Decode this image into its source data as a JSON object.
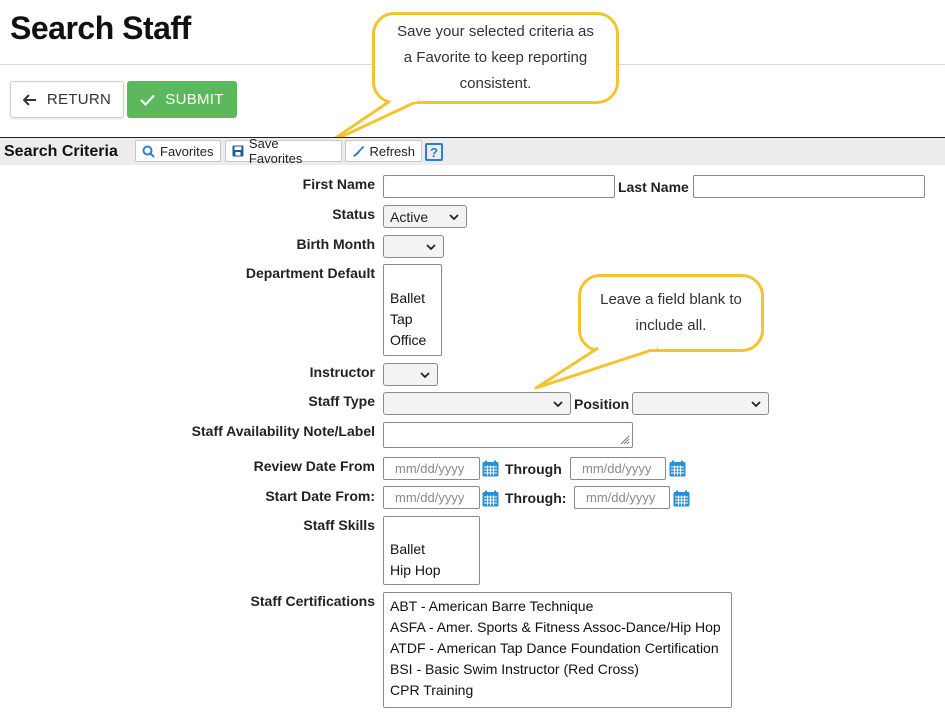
{
  "page": {
    "title": "Search Staff"
  },
  "actions": {
    "return_label": "RETURN",
    "submit_label": "SUBMIT"
  },
  "criteria_bar": {
    "title": "Search Criteria",
    "favorites_label": "Favorites",
    "save_favorites_label": "Save Favorites",
    "refresh_label": "Refresh",
    "help_label": "?"
  },
  "callouts": {
    "favorites_tip": "Save your selected criteria as a Favorite to keep reporting consistent.",
    "blank_tip": "Leave a field blank to include all."
  },
  "form": {
    "first_name": {
      "label": "First Name",
      "value": ""
    },
    "last_name": {
      "label": "Last Name",
      "value": ""
    },
    "status": {
      "label": "Status",
      "value": "Active"
    },
    "birth_month": {
      "label": "Birth Month",
      "value": ""
    },
    "department_default": {
      "label": "Department Default",
      "options": [
        "Ballet",
        "Tap",
        "Office"
      ]
    },
    "instructor": {
      "label": "Instructor",
      "value": ""
    },
    "staff_type": {
      "label": "Staff Type",
      "value": ""
    },
    "position": {
      "label": "Position",
      "value": ""
    },
    "availability_note": {
      "label": "Staff Availability Note/Label",
      "value": ""
    },
    "review_date": {
      "label": "Review Date From",
      "through_label": "Through",
      "placeholder": "mm/dd/yyyy"
    },
    "start_date": {
      "label": "Start Date From:",
      "through_label": "Through:",
      "placeholder": "mm/dd/yyyy"
    },
    "staff_skills": {
      "label": "Staff Skills",
      "options": [
        "Ballet",
        "Hip Hop"
      ]
    },
    "staff_certifications": {
      "label": "Staff Certifications",
      "options": [
        "ABT - American Barre Technique",
        "ASFA - Amer. Sports & Fitness Assoc-Dance/Hip Hop",
        "ATDF - American Tap Dance Foundation Certification",
        "BSI - Basic Swim Instructor (Red Cross)",
        "CPR Training"
      ]
    }
  },
  "colors": {
    "submit_green": "#5cb85c",
    "callout_border": "#f4c430",
    "link_blue": "#2a7fd4",
    "calendar_blue": "#2a8fd4"
  },
  "icons": [
    "arrow-left-icon",
    "check-icon",
    "search-icon",
    "save-icon",
    "broom-icon",
    "help-icon",
    "chevron-down-icon",
    "calendar-icon"
  ]
}
